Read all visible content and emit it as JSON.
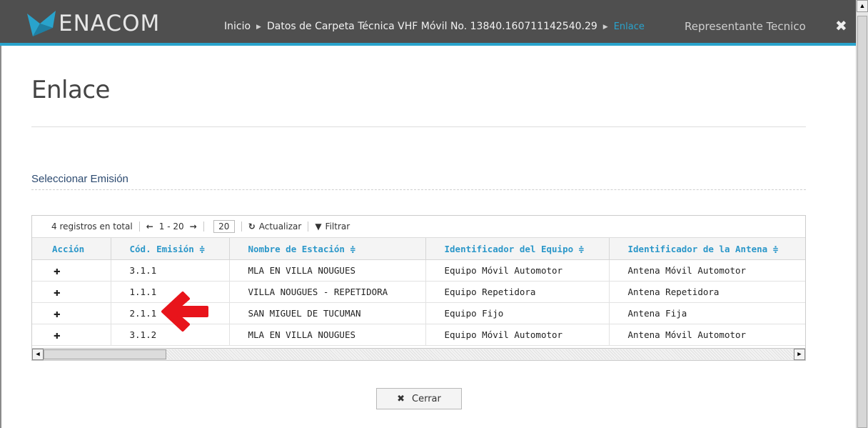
{
  "header": {
    "logo_text": "ENACOM",
    "breadcrumb": {
      "home": "Inicio",
      "carpeta": "Datos de Carpeta Técnica VHF Móvil No. 13840.160711142540.29",
      "current": "Enlace"
    },
    "user_link": "Representante Tecnico",
    "close_glyph": "✖"
  },
  "page": {
    "title": "Enlace",
    "section_label": "Seleccionar Emisión"
  },
  "toolbar": {
    "total": "4 registros en total",
    "prev": "🡐",
    "range": "1 - 20",
    "next": "🡒",
    "page_size": "20",
    "refresh_icon": "refresh-icon",
    "refresh": "Actualizar",
    "filter_icon": "filter-icon",
    "filter": "Filtrar"
  },
  "table": {
    "columns": [
      "Acción",
      "Cód. Emisión ≑",
      "Nombre de Estación ≑",
      "Identificador del Equipo ≑",
      "Identificador de la Antena ≑"
    ],
    "rows": [
      {
        "action": "✚",
        "cod": "3.1.1",
        "nombre": "MLA EN VILLA NOUGUES",
        "equipo": "Equipo Móvil Automotor",
        "antena": "Antena Móvil Automotor"
      },
      {
        "action": "✚",
        "cod": "1.1.1",
        "nombre": "VILLA NOUGUES - REPETIDORA",
        "equipo": "Equipo Repetidora",
        "antena": "Antena Repetidora"
      },
      {
        "action": "✚",
        "cod": "2.1.1",
        "nombre": "SAN MIGUEL DE TUCUMAN",
        "equipo": "Equipo Fijo",
        "antena": "Antena Fija"
      },
      {
        "action": "✚",
        "cod": "3.1.2",
        "nombre": "MLA EN VILLA NOUGUES",
        "equipo": "Equipo Móvil Automotor",
        "antena": "Antena Móvil Automotor"
      }
    ]
  },
  "footer": {
    "close_icon": "✖",
    "close_label": "Cerrar"
  },
  "colors": {
    "topbar": "#4f4f4f",
    "accent": "#29a3cc",
    "annotation_arrow": "#e8141b"
  }
}
